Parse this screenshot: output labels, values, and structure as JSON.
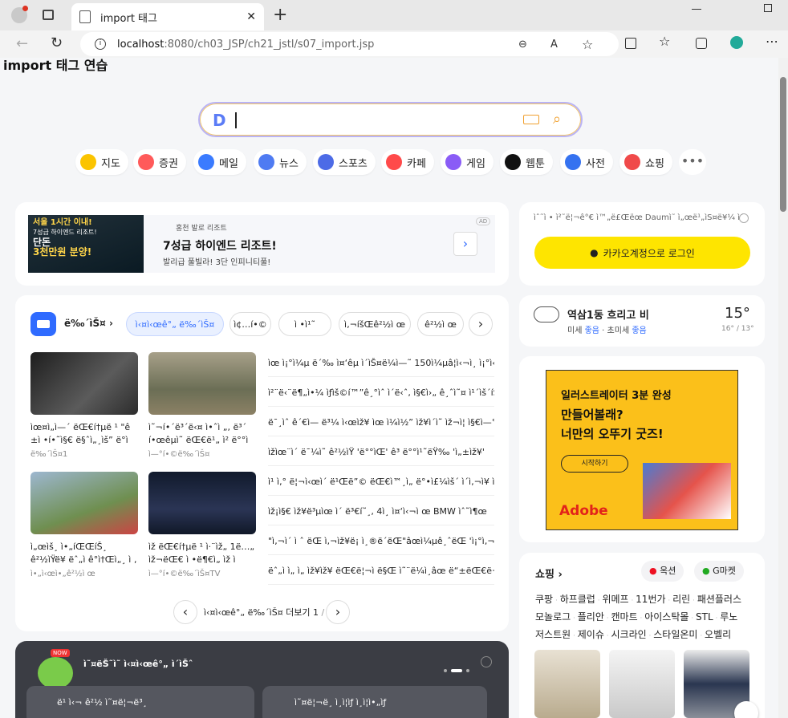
{
  "browser": {
    "tab_title": "import 태그",
    "url_host": "localhost",
    "url_rest": ":8080/ch03_JSP/ch21_jstl/s07_import.jsp"
  },
  "page_heading": "import 태그 연습",
  "shortcuts": [
    "지도",
    "증권",
    "메일",
    "뉴스",
    "스포츠",
    "카페",
    "게임",
    "웹툰",
    "사전",
    "쇼핑"
  ],
  "ad_banner": {
    "badge": "AD",
    "img_line1": "서울 1시간 이내!",
    "img_line2": "7성급 하이엔드 리조트!",
    "img_line3": "단돈",
    "img_line4": "3천만원 분양!",
    "source": "홍천 발로 리조트",
    "title": "7성급 하이엔드 리조트!",
    "desc": "발리급 풀빌라! 3단 인피니티풀!"
  },
  "login": {
    "info": "ìˆ˜ì • ì²˜ë¦¬ê°€ ì™„ë£Œëœ Daumì˜ ì„œë¹„ìŠ¤ë¥¼ ì´ìš©í•˜ì„¸ìš”",
    "button": "카카오계정으로 로그인"
  },
  "weather": {
    "desc": "역삼1동 흐리고 비",
    "dust_label": "미세",
    "dust_val": "좋음",
    "ultra_label": "초미세",
    "ultra_val": "좋음",
    "temp": "15°",
    "range": "16° / 13°"
  },
  "news": {
    "title": "ë‰´ìŠ¤",
    "pills": [
      "ì‹¤ì‹œê°„ ë‰´ìŠ¤",
      "ì¢…í•©",
      "ì •ì¹˜",
      "ì‚¬íšŒê²½ì œ",
      "ê²½ì œ"
    ],
    "items": [
      {
        "cap": "ìœ¤ì„ì—´ ëŒ€í†µë ¹ \"ê ±ì •í•˜ì§€ ë§ˆì„¸ìš” ë°ì´í„°",
        "src": "ë‰´ìŠ¤1"
      },
      {
        "cap": "ì˜¬í•´ë³´ë‹¤ ì•ˆì „, ë³´ í•œêµ­ì˜ ëŒ€ë¹„ ì² ë°°ì—ˆë‹¤",
        "src": "ì—°í•©ë‰´ìŠ¤"
      },
      {
        "cap": "ì„œìš¸ ì•„íŒŒíŠ¸ ê²½ìŸë¥  ëˆ„ì  ê°ì†Œì„¸ ì ‚ ìœ„",
        "src": "ì•„ì‹œì•„ê²½ì œ"
      },
      {
        "cap": "ìž ëŒ€í†µë ¹ ì·¨ìž„ 1ë…„ ìž¬ëŒ€ ì •ë¶€ì„ ìž ì •ë¶€",
        "src": "ì—°í•©ë‰´ìŠ¤TV"
      }
    ],
    "headlines": [
      "ìœ ì¡°ì¼µ ë´‰ ì¤‘êµ­ ì´ìŠ¤ë¼ì—˜ 150ì¼µâ¦ì‹¬ì¸ ì¡°ì‹¬",
      "ì²¨ë‹¨ë¶„ì•¼ ìƒìš©í™”ê¸°ìˆ ì´ë‹ˆ, ì§€ì›„ ê¸ˆì˜¤ ì¹´ìš´íŠ¸ë‹¤ìš´",
      "ë¯¸ìˆ ê´€ì— ë³¼ ì‹œìž¥ ìœ ì¼ì½” ìž¥ì´ì˜ ìž¬ì¦ ì§€ì—°",
      "ìžìœ¨ì´ ë¯¼ì˜ ê²½ìŸ 'ë°°ìŒ' ê³  ë°°ì¹˜ëŸ‰ 'ì„±ìž¥'",
      "ì¹ ì‚° ë¦¬ì‹œì´ ë¹Œë”© ëŒ€ì™¸ì„ ë°•ì£¼ìš´ ì´ì‚¬ì¥ ì—°ìž¥",
      "ìž¡ì§€ ìž¥ë³µìœ ì´ ë³€í˜¸, 4ì¸ ì¤‘ì‹¬ì œ BMW ìˆ˜ì¶œ",
      "\"ì‚¬ì´ ì ˆ ëŒ ì‚¬ìž¥ë¡  ì¸®ë´ëŒ\"âœì¼µê¸ˆëŒ 'ì¡°ì‚¬'",
      "ëˆ„ì ì„ ì„ ìž¥ìž¥ ëŒ€ë¦¬ì ë§Œ ì˜¨ë¼ì¸âœ ë“±ëŒ€ë¬´ì„ ìž…ë‹ˆë‹¤"
    ],
    "more": "ì‹¤ì‹œê°„ ë‰´ìŠ¤ 더보기",
    "page_cur": "1",
    "page_total": "/ 3"
  },
  "promo": {
    "badge": "NOW",
    "title": "ì˜¤ëŠ˜ì˜ ì‹¤ì‹œê°„ ì´ìŠˆ",
    "chip1": "ë¹ ì‹¬ ê²½ ì˜¤ë¦¬ë³¸",
    "chip2": "ì˜¤ë¦¬ë¸ ì¸ì¦ìƒ ì¸ì¦ì•„ìƒ"
  },
  "adobe_ad": {
    "line1": "일러스트레이터 3분 완성",
    "line2": "만들어볼래?",
    "line3": "너만의 오뚜기 굿즈!",
    "cta": "시작하기",
    "brand": "Adobe"
  },
  "shopping": {
    "title": "쇼핑",
    "partner1": "옥션",
    "partner2": "G마켓",
    "tags_row1": [
      "쿠팡",
      "하프클럽",
      "위메프",
      "11번가",
      "리린",
      "패션플러스"
    ],
    "tags_row2": [
      "모놀로그",
      "플리안",
      "캔마트",
      "아이스탁몰",
      "STL",
      "루노"
    ],
    "tags_row3": [
      "저스트원",
      "제이슈",
      "시크라인",
      "스타일온미",
      "오벨리"
    ]
  },
  "colors": {
    "kakao_yellow": "#fee500",
    "accent_blue": "#2f6bff",
    "promo_bg": "#3b3d44"
  }
}
